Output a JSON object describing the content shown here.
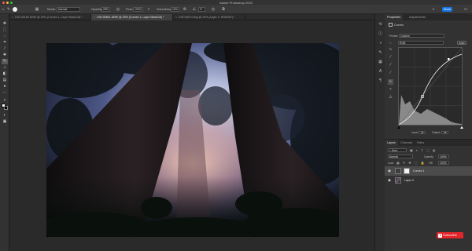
{
  "app": {
    "title": "Adobe Photoshop 2023"
  },
  "options_bar": {
    "mode_label": "Mode:",
    "mode_value": "Normal",
    "opacity_label": "Opacity:",
    "opacity_value": "28%",
    "flow_label": "Flow:",
    "flow_value": "100%",
    "smoothing_label": "Smoothing:",
    "smoothing_value": "10%",
    "angle_value": "0°",
    "share_label": "Share"
  },
  "tabs": [
    {
      "label": "DSC05180.ARW @ 25% (Curves 1, Layer Mask/16) *",
      "active": false
    },
    {
      "label": "DSC05801.ARW @ 25% (Curves 1, Layer Mask/16) *",
      "active": true
    },
    {
      "label": "DSC05574.dng @ 25% (Layer 0, RGB/16*) *",
      "active": false
    }
  ],
  "properties": {
    "tabs": [
      "Properties",
      "Adjustments"
    ],
    "adjustment_name": "Curves",
    "preset_label": "Preset:",
    "preset_value": "Custom",
    "channel_value": "RGB",
    "auto_label": "Auto",
    "input_label": "Input:",
    "input_value": "81",
    "output_label": "Output:",
    "output_value": "48"
  },
  "layers": {
    "tabs": [
      "Layers",
      "Channels",
      "Paths"
    ],
    "kind_label": "Kind",
    "blend_value": "Normal",
    "opacity_label": "Opacity:",
    "opacity_value": "100%",
    "lock_label": "Lock:",
    "fill_label": "Fill:",
    "fill_value": "100%",
    "items": [
      {
        "name": "Curves 1",
        "selected": true
      },
      {
        "name": "Layer 0",
        "selected": false
      }
    ]
  },
  "subscribe": {
    "label": "Subscribe"
  },
  "colors": {
    "accent": "#1473e6",
    "subscribe_red": "#e4262b"
  }
}
